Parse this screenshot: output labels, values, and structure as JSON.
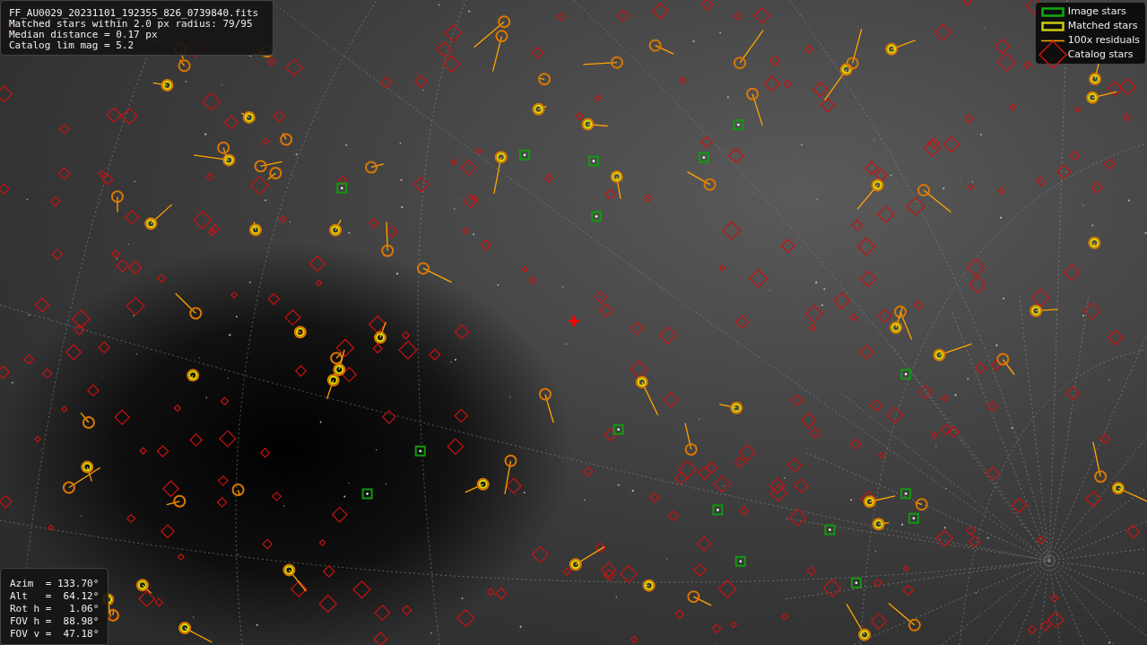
{
  "info_box": {
    "lines": [
      "FF_AU0029_20231101_192355_826_0739840.fits",
      "Matched stars within 2.0 px radius: 79/95",
      "Median distance = 0.17 px",
      "Catalog lim mag = 5.2"
    ]
  },
  "legend": {
    "items": [
      {
        "kind": "image",
        "label": "Image stars"
      },
      {
        "kind": "matched",
        "label": "Matched stars"
      },
      {
        "kind": "residual",
        "label": "100x residuals"
      },
      {
        "kind": "catalog",
        "label": "Catalog stars"
      }
    ]
  },
  "pointing_box": {
    "lines": [
      "Azim  = 133.70°",
      "Alt   =  64.12°",
      "Rot h =   1.06°",
      "FOV h =  88.98°",
      "FOV v =  47.18°"
    ]
  }
}
